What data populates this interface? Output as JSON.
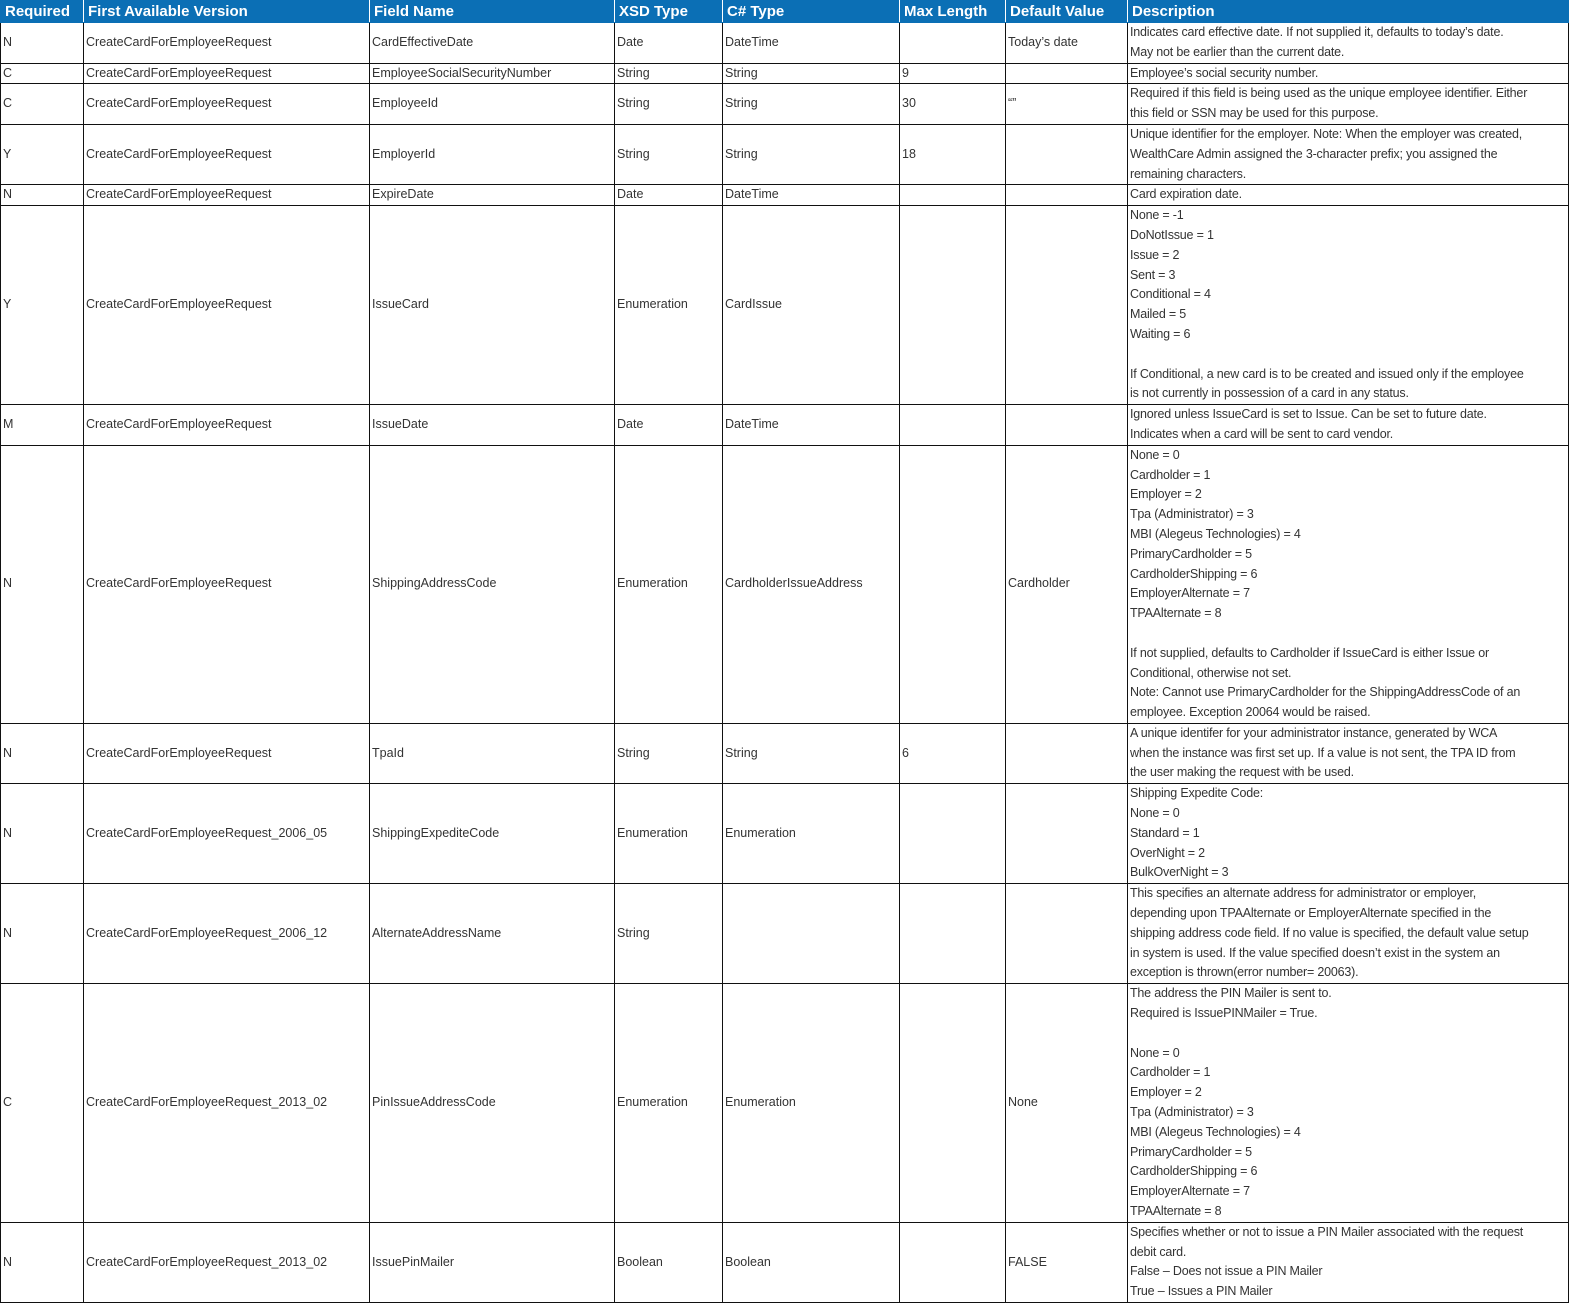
{
  "columns": [
    "Required",
    "First Available Version",
    "Field Name",
    "XSD Type",
    "C# Type",
    "Max Length",
    "Default Value",
    "Description"
  ],
  "rows": [
    [
      "N",
      "CreateCardForEmployeeRequest",
      "CardEffectiveDate",
      "Date",
      "DateTime",
      "",
      "Today’s date",
      "Indicates card effective date. If not supplied it, defaults to today’s date.\nMay not be earlier than the current date."
    ],
    [
      "C",
      "CreateCardForEmployeeRequest",
      "EmployeeSocialSecurityNumber",
      "String",
      "String",
      "9",
      "",
      "Employee’s social security number."
    ],
    [
      "C",
      "CreateCardForEmployeeRequest",
      "EmployeeId",
      "String",
      "String",
      "30",
      "“”",
      "Required if this field is being used as the unique employee identifier. Either\nthis field or SSN may be used for this purpose."
    ],
    [
      "Y",
      "CreateCardForEmployeeRequest",
      "EmployerId",
      "String",
      "String",
      "18",
      "",
      "Unique identifier for the employer. Note: When the employer was created,\nWealthCare Admin assigned the 3-character prefix; you assigned the\nremaining characters."
    ],
    [
      "N",
      "CreateCardForEmployeeRequest",
      "ExpireDate",
      "Date",
      "DateTime",
      "",
      "",
      "Card expiration date."
    ],
    [
      "Y",
      "CreateCardForEmployeeRequest",
      "IssueCard",
      "Enumeration",
      "CardIssue",
      "",
      "",
      "None = -1\nDoNotIssue = 1\nIssue = 2\nSent = 3\nConditional = 4\nMailed = 5\nWaiting = 6\n\nIf Conditional, a new card is to be created and issued only if the employee\nis not currently in possession of a card in any status."
    ],
    [
      "M",
      "CreateCardForEmployeeRequest",
      "IssueDate",
      "Date",
      "DateTime",
      "",
      "",
      "Ignored unless IssueCard is set to Issue. Can be set to future date.\nIndicates when a card will be sent to card vendor."
    ],
    [
      "N",
      "CreateCardForEmployeeRequest",
      "ShippingAddressCode",
      "Enumeration",
      "CardholderIssueAddress",
      "",
      "Cardholder",
      "None = 0\nCardholder = 1\nEmployer = 2\nTpa (Administrator) = 3\nMBI (Alegeus Technologies) = 4\nPrimaryCardholder = 5\nCardholderShipping = 6\nEmployerAlternate  = 7\nTPAAlternate = 8\n\nIf not supplied, defaults to Cardholder if IssueCard is either Issue or\nConditional, otherwise not set.\nNote: Cannot use PrimaryCardholder for the ShippingAddressCode of an\nemployee. Exception 20064 would be raised."
    ],
    [
      "N",
      "CreateCardForEmployeeRequest",
      "TpaId",
      "String",
      "String",
      "6",
      "",
      "A unique identifer for your administrator instance, generated by WCA\nwhen the instance was first set up. If a value is not sent, the TPA ID from\nthe user making the request with be used."
    ],
    [
      "N",
      "CreateCardForEmployeeRequest_2006_05",
      "ShippingExpediteCode",
      "Enumeration",
      "Enumeration",
      "",
      "",
      "Shipping Expedite Code:\nNone = 0\nStandard = 1\nOverNight = 2\nBulkOverNight = 3"
    ],
    [
      "N",
      "CreateCardForEmployeeRequest_2006_12",
      "AlternateAddressName",
      "String",
      "",
      "",
      "",
      "This specifies an alternate address for administrator or employer,\ndepending upon TPAAlternate or EmployerAlternate specified in the\nshipping address code field. If no value is specified, the default value setup\nin system is used. If the value specified doesn’t exist in the system an\nexception is thrown(error number= 20063)."
    ],
    [
      "C",
      "CreateCardForEmployeeRequest_2013_02",
      "PinIssueAddressCode",
      "Enumeration",
      "Enumeration",
      "",
      "None",
      "The address the PIN Mailer is sent to.\nRequired is IssuePINMailer = True.\n\nNone = 0\nCardholder = 1\nEmployer = 2\nTpa (Administrator) = 3\nMBI (Alegeus Technologies) = 4\nPrimaryCardholder = 5\nCardholderShipping = 6\nEmployerAlternate  = 7\nTPAAlternate = 8"
    ],
    [
      "N",
      "CreateCardForEmployeeRequest_2013_02",
      "IssuePinMailer",
      "Boolean",
      "Boolean",
      "",
      "FALSE",
      "Specifies whether or not to issue a PIN Mailer associated with the request\ndebit card.\nFalse – Does not issue a PIN Mailer\nTrue – Issues a PIN Mailer"
    ]
  ]
}
